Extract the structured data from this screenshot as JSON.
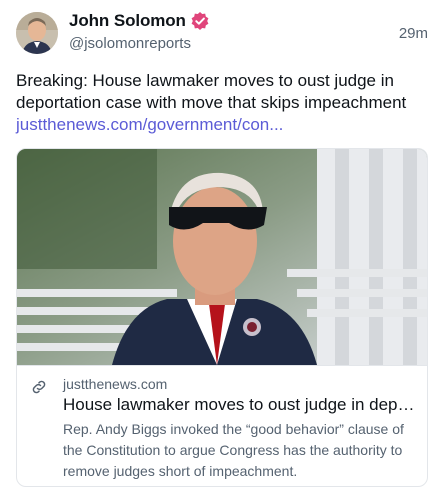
{
  "author": {
    "name": "John Solomon",
    "handle": "@jsolomonreports",
    "time": "29m",
    "verified_color": "#e0457b"
  },
  "post": {
    "text": "Breaking: House lawmaker moves to oust judge in deportation case with move that skips impeachment",
    "link": "justthenews.com/government/con..."
  },
  "card": {
    "domain": "justthenews.com",
    "title": "House lawmaker moves to oust judge in deport...",
    "description": "Rep. Andy Biggs invoked the “good behavior” clause of the Constitution to argue Congress has the authority to remove judges short of impeachment."
  },
  "colors": {
    "link": "#5b5bd6",
    "secondary_text": "#556270"
  }
}
